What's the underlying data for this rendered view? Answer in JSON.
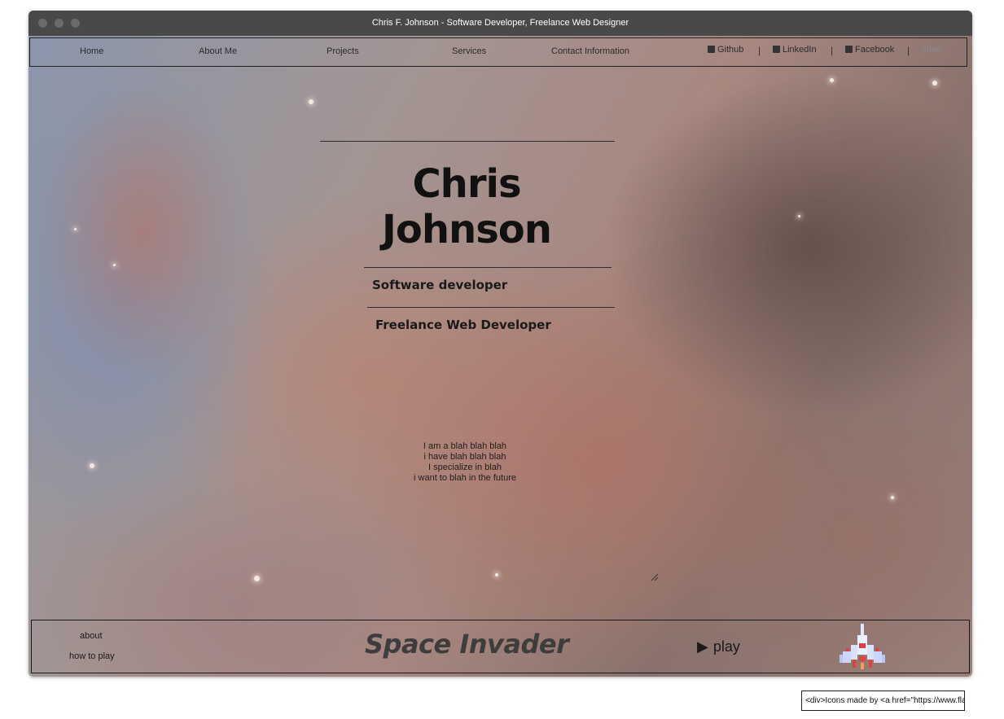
{
  "window": {
    "title": "Chris F. Johnson - Software  Developer, Freelance Web Designer"
  },
  "nav": {
    "items": [
      {
        "label": "Home"
      },
      {
        "label": "About Me"
      },
      {
        "label": "Projects"
      },
      {
        "label": "Services"
      },
      {
        "label": "Contact Information"
      }
    ],
    "social": [
      {
        "label": "Github",
        "icon": "github-icon"
      },
      {
        "label": "LinkedIn",
        "icon": "linkedin-icon"
      },
      {
        "label": "Facebook",
        "icon": "facebook-icon"
      },
      {
        "label": "other"
      }
    ],
    "separator": "|"
  },
  "hero": {
    "name": "Chris Johnson",
    "roles": [
      "Software developer",
      "Freelance Web Developer"
    ],
    "bio": [
      "I am a blah blah blah",
      "i have blah blah blah",
      "I specialize in blah",
      "i want to blah in the future"
    ]
  },
  "game": {
    "links": [
      "about",
      "how to play"
    ],
    "title": "Space Invader",
    "play_label": "play",
    "play_icon": "play-triangle-icon",
    "ship_icon": "spaceship-icon"
  },
  "attribution": {
    "text": "<div>Icons made by <a href=\"https://www.flaticon.com/authors/freepik\""
  },
  "colors": {
    "titlebar": "#494949",
    "nav_border": "#222222",
    "text": "#111111"
  }
}
